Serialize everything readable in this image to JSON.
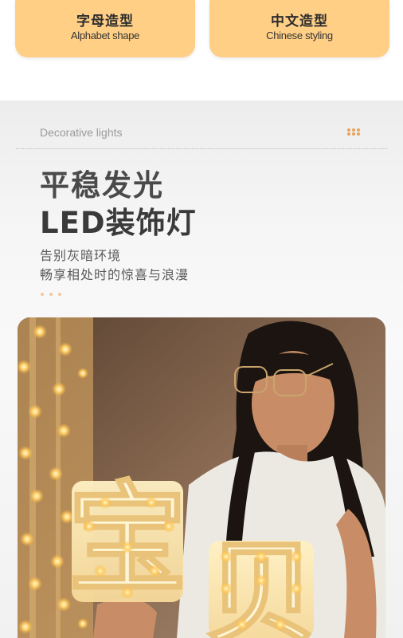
{
  "tabs": [
    {
      "label_cn": "字母造型",
      "label_en": "Alphabet shape"
    },
    {
      "label_cn": "中文造型",
      "label_en": "Chinese styling"
    }
  ],
  "feature": {
    "subtitle_en": "Decorative lights",
    "title_line1": "平稳发光",
    "title_line2": "LED装饰灯",
    "desc_line1": "告别灰暗环境",
    "desc_line2": "畅享相处时的惊喜与浪漫"
  },
  "photo": {
    "letters": [
      "宝",
      "贝"
    ]
  },
  "colors": {
    "tab_bg": "#ffcf86",
    "accent_dots": "#e8a35a",
    "title_text": "#3a3a3a"
  },
  "icons": {
    "menu_dots": "dots-icon"
  }
}
